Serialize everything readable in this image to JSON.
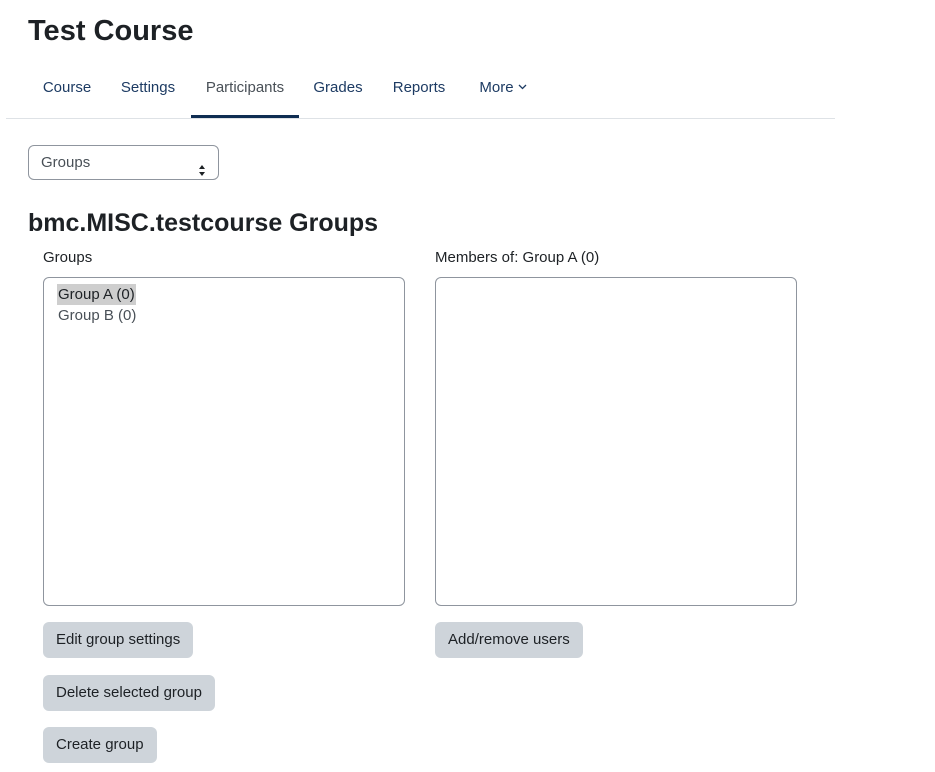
{
  "page": {
    "title": "Test Course"
  },
  "nav": {
    "tabs": [
      {
        "label": "Course"
      },
      {
        "label": "Settings"
      },
      {
        "label": "Participants",
        "active": true
      },
      {
        "label": "Grades"
      },
      {
        "label": "Reports"
      },
      {
        "label": "More",
        "icon": "chevron-down-icon"
      }
    ]
  },
  "view_select": {
    "value": "Groups",
    "icon": "select-arrows-icon"
  },
  "groups_page": {
    "heading": "bmc.MISC.testcourse Groups",
    "groups_label": "Groups",
    "members_label": "Members of: Group A (0)",
    "groups": [
      {
        "label": "Group A (0)",
        "selected": true
      },
      {
        "label": "Group B (0)",
        "selected": false
      }
    ],
    "members": []
  },
  "buttons": {
    "edit_group_settings": "Edit group settings",
    "delete_selected_group": "Delete selected group",
    "create_group": "Create group",
    "add_remove_users": "Add/remove users"
  },
  "colors": {
    "button_bg": "#ced4da",
    "active_tab_underline": "#0f2d52",
    "selected_option_bg": "#cecece"
  }
}
